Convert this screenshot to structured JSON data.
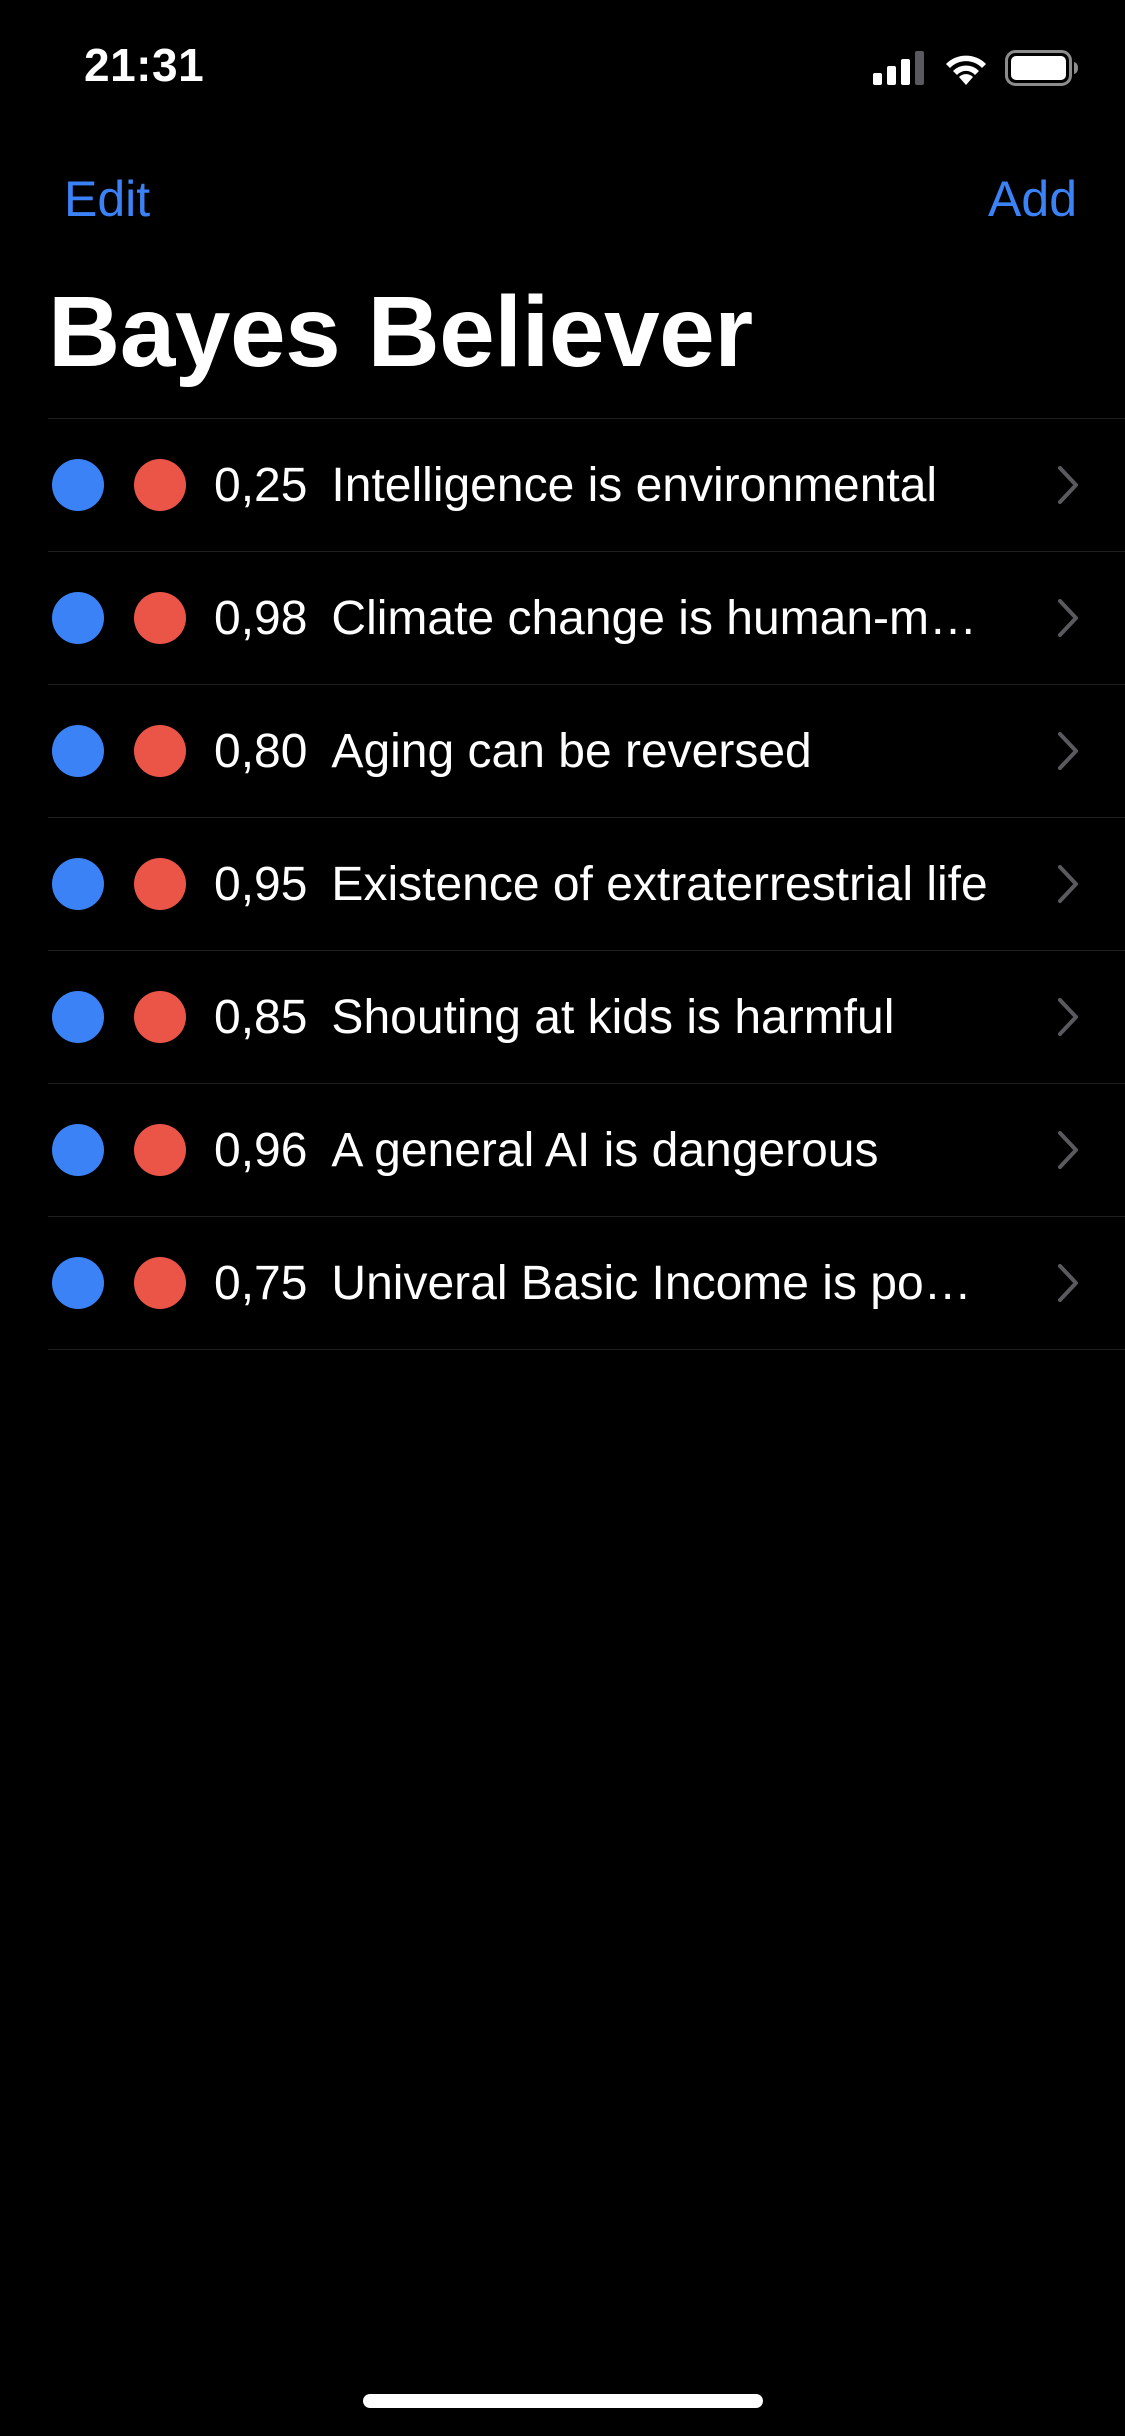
{
  "status_bar": {
    "time": "21:31",
    "icons": [
      "cellular-signal-icon",
      "wifi-icon",
      "battery-icon"
    ]
  },
  "nav": {
    "edit_label": "Edit",
    "add_label": "Add"
  },
  "title": "Bayes Believer",
  "colors": {
    "accent": "#3b82f6",
    "blue_dot": "#3b82f6",
    "red_dot": "#ea5548",
    "background": "#000000",
    "separator": "#1f1f22",
    "chevron": "#5a5a5e"
  },
  "beliefs": [
    {
      "probability": "0,25",
      "text": "Intelligence is environmental"
    },
    {
      "probability": "0,98",
      "text": "Climate change is human-made"
    },
    {
      "probability": "0,80",
      "text": "Aging can be reversed"
    },
    {
      "probability": "0,95",
      "text": "Existence of extraterrestrial life"
    },
    {
      "probability": "0,85",
      "text": "Shouting at kids is harmful"
    },
    {
      "probability": "0,96",
      "text": "A general AI is dangerous"
    },
    {
      "probability": "0,75",
      "text": "Univeral Basic Income is possible"
    }
  ]
}
